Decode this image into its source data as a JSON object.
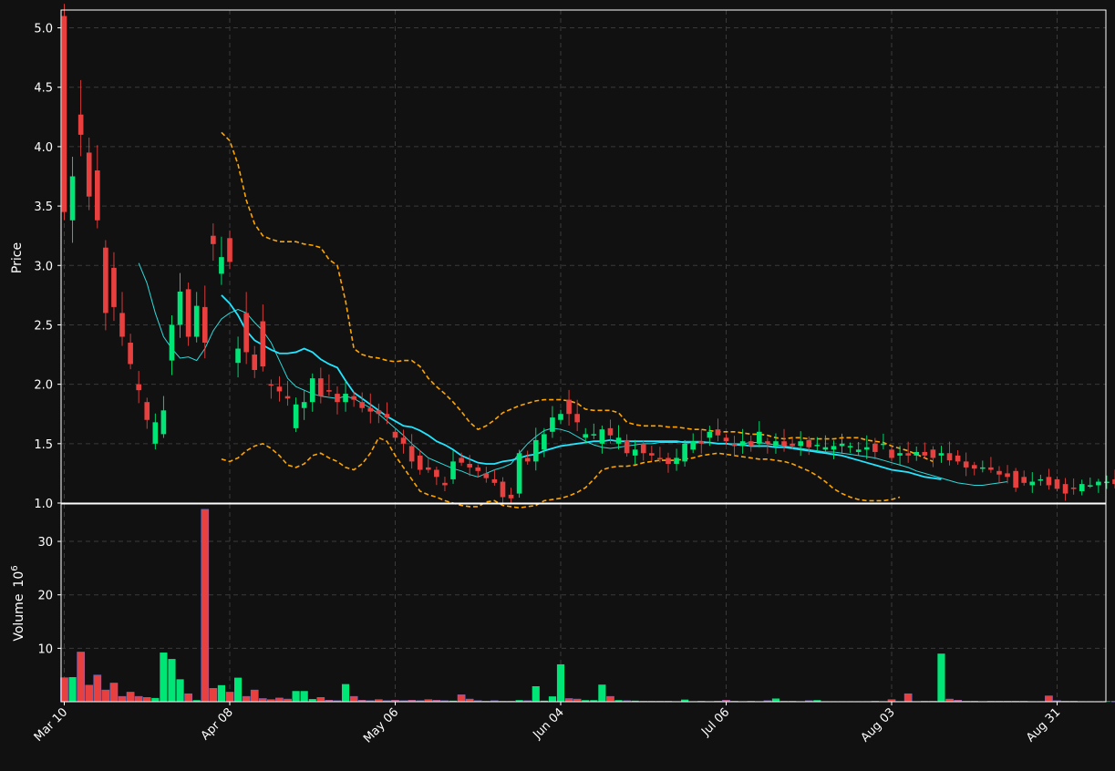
{
  "chart_data": {
    "type": "candlestick",
    "colors": {
      "background": "#111111",
      "up": "#00e676",
      "down": "#e8403f",
      "grid": "#3a3a3a",
      "axis": "#ffffff",
      "ma_fast": "#2fd8d8",
      "ma_slow": "#22e5ff",
      "bollinger": "#ffa500"
    },
    "price_panel": {
      "ylabel": "Price",
      "ylim": [
        1.0,
        5.15
      ],
      "yticks": [
        "1.0",
        "1.5",
        "2.0",
        "2.5",
        "3.0",
        "3.5",
        "4.0",
        "4.5",
        "5.0"
      ],
      "ytick_values": [
        1.0,
        1.5,
        2.0,
        2.5,
        3.0,
        3.5,
        4.0,
        4.5,
        5.0
      ]
    },
    "volume_panel": {
      "ylabel": "Volume",
      "ylabel_unit": "10",
      "ylabel_exp": "6",
      "ylim": [
        0,
        37
      ],
      "yticks": [
        "10",
        "20",
        "30"
      ],
      "ytick_values": [
        10,
        20,
        30
      ]
    },
    "x_axis": {
      "tick_labels": [
        "Mar 10",
        "Apr 08",
        "May 06",
        "Jun 04",
        "Jul 06",
        "Aug 03",
        "Aug 31"
      ],
      "tick_indices": [
        0,
        20,
        40,
        60,
        80,
        100,
        120
      ]
    },
    "grid": true,
    "candles": {
      "open": [
        5.1,
        3.38,
        4.27,
        3.95,
        3.8,
        3.15,
        2.98,
        2.6,
        2.35,
        2.0,
        1.85,
        1.5,
        1.58,
        2.2,
        2.5,
        2.8,
        2.4,
        2.65,
        3.25,
        2.93,
        3.23,
        2.18,
        2.6,
        2.25,
        2.53,
        2.0,
        1.98,
        1.9,
        1.63,
        1.8,
        1.85,
        2.05,
        1.95,
        1.92,
        1.85,
        1.9,
        1.85,
        1.8,
        1.78,
        1.75,
        1.6,
        1.55,
        1.48,
        1.4,
        1.3,
        1.28,
        1.17,
        1.2,
        1.38,
        1.33,
        1.3,
        1.25,
        1.2,
        1.18,
        1.07,
        1.08,
        1.38,
        1.35,
        1.45,
        1.6,
        1.7,
        1.87,
        1.75,
        1.55,
        1.57,
        1.5,
        1.63,
        1.5,
        1.53,
        1.4,
        1.5,
        1.42,
        1.38,
        1.38,
        1.33,
        1.35,
        1.45,
        1.52,
        1.55,
        1.62,
        1.55,
        1.5,
        1.48,
        1.52,
        1.5,
        1.52,
        1.48,
        1.52,
        1.5,
        1.48,
        1.53,
        1.48,
        1.45,
        1.45,
        1.48,
        1.47,
        1.43,
        1.45,
        1.5,
        1.5,
        1.45,
        1.4,
        1.42,
        1.4,
        1.43,
        1.45,
        1.4,
        1.42,
        1.4,
        1.35,
        1.32,
        1.3,
        1.3,
        1.27,
        1.25,
        1.27,
        1.22,
        1.15,
        1.2,
        1.22,
        1.2,
        1.16,
        1.13,
        1.1,
        1.15,
        1.15,
        1.17,
        1.2,
        1.18,
        1.15,
        1.17,
        1.23,
        1.25
      ],
      "close": [
        3.45,
        3.75,
        4.1,
        3.58,
        3.38,
        2.6,
        2.65,
        2.4,
        2.17,
        1.95,
        1.7,
        1.68,
        1.78,
        2.5,
        2.78,
        2.4,
        2.66,
        2.35,
        3.18,
        3.07,
        3.03,
        2.3,
        2.27,
        2.12,
        2.15,
        1.99,
        1.94,
        1.88,
        1.83,
        1.85,
        2.05,
        1.9,
        1.94,
        1.85,
        1.92,
        1.87,
        1.8,
        1.77,
        1.75,
        1.72,
        1.55,
        1.5,
        1.35,
        1.28,
        1.28,
        1.22,
        1.15,
        1.35,
        1.34,
        1.3,
        1.27,
        1.21,
        1.17,
        1.05,
        1.04,
        1.42,
        1.35,
        1.53,
        1.58,
        1.72,
        1.75,
        1.75,
        1.68,
        1.58,
        1.58,
        1.62,
        1.57,
        1.55,
        1.42,
        1.45,
        1.42,
        1.4,
        1.37,
        1.33,
        1.38,
        1.5,
        1.52,
        1.5,
        1.6,
        1.57,
        1.52,
        1.48,
        1.52,
        1.48,
        1.6,
        1.5,
        1.52,
        1.48,
        1.48,
        1.52,
        1.47,
        1.49,
        1.47,
        1.48,
        1.5,
        1.48,
        1.45,
        1.47,
        1.43,
        1.5,
        1.38,
        1.42,
        1.4,
        1.43,
        1.4,
        1.38,
        1.42,
        1.36,
        1.35,
        1.3,
        1.29,
        1.3,
        1.28,
        1.24,
        1.22,
        1.13,
        1.17,
        1.18,
        1.2,
        1.15,
        1.12,
        1.08,
        1.12,
        1.16,
        1.15,
        1.18,
        1.18,
        1.16,
        1.2,
        1.25,
        1.2
      ]
    },
    "volume": [
      4.5,
      4.6,
      9.3,
      3.1,
      5.0,
      2.2,
      3.5,
      1.0,
      1.8,
      1.0,
      0.8,
      0.7,
      9.2,
      8.0,
      4.2,
      1.5,
      0.3,
      36.0,
      2.5,
      3.1,
      1.8,
      4.5,
      1.0,
      2.2,
      0.6,
      0.4,
      0.7,
      0.5,
      2.0,
      2.0,
      0.5,
      0.8,
      0.3,
      0.2,
      3.3,
      1.0,
      0.3,
      0.2,
      0.4,
      0.2,
      0.3,
      0.2,
      0.3,
      0.2,
      0.4,
      0.3,
      0.2,
      0.2,
      1.3,
      0.5,
      0.2,
      0.1,
      0.2,
      0.1,
      0.1,
      0.3,
      0.2,
      2.9,
      0.2,
      1.0,
      7.0,
      0.6,
      0.5,
      0.3,
      0.3,
      3.2,
      1.0,
      0.3,
      0.2,
      0.2,
      0.1,
      0.1,
      0.1,
      0.1,
      0.1,
      0.4,
      0.1,
      0.1,
      0.1,
      0.1,
      0.3,
      0.1,
      0.1,
      0.1,
      0.1,
      0.2,
      0.6,
      0.1,
      0.1,
      0.1,
      0.2,
      0.3,
      0.1,
      0.1,
      0.1,
      0.1,
      0.1,
      0.1,
      0.1,
      0.1,
      0.4,
      0.1,
      1.5,
      0.1,
      0.1,
      0.1,
      9.0,
      0.5,
      0.3,
      0.1,
      0.1,
      0.1,
      0.1,
      0.1,
      0.1,
      0.1,
      0.1,
      0.1,
      0.1,
      1.1,
      0.2,
      0.1,
      0.1,
      0.1,
      0.1,
      0.1,
      0.1,
      0.1,
      0.1,
      0.1,
      0.1,
      0.1,
      0.1,
      0.1,
      0.2,
      0.1,
      0.1,
      0.1,
      0.3,
      0.1
    ],
    "ma_fast": [
      null,
      null,
      null,
      null,
      null,
      null,
      null,
      null,
      null,
      3.02,
      2.85,
      2.6,
      2.4,
      2.3,
      2.22,
      2.23,
      2.2,
      2.3,
      2.45,
      2.55,
      2.6,
      2.63,
      2.6,
      2.52,
      2.45,
      2.35,
      2.2,
      2.05,
      1.98,
      1.95,
      1.92,
      1.9,
      1.89,
      1.88,
      1.9,
      1.88,
      1.84,
      1.8,
      1.75,
      1.69,
      1.63,
      1.57,
      1.5,
      1.44,
      1.38,
      1.35,
      1.32,
      1.29,
      1.27,
      1.24,
      1.22,
      1.25,
      1.28,
      1.3,
      1.33,
      1.42,
      1.5,
      1.56,
      1.61,
      1.63,
      1.62,
      1.6,
      1.56,
      1.52,
      1.49,
      1.47,
      1.46,
      1.47,
      1.48,
      1.49,
      1.5,
      1.5,
      1.51,
      1.51,
      1.51,
      1.52,
      1.52,
      1.52,
      1.51,
      1.5,
      1.5,
      1.5,
      1.5,
      1.51,
      1.51,
      1.5,
      1.49,
      1.48,
      1.47,
      1.46,
      1.45,
      1.44,
      1.43,
      1.43,
      1.42,
      1.41,
      1.4,
      1.39,
      1.38,
      1.36,
      1.34,
      1.32,
      1.3,
      1.27,
      1.25,
      1.23,
      1.21,
      1.19,
      1.17,
      1.16,
      1.15,
      1.15,
      1.16,
      1.17,
      1.18
    ],
    "ma_slow": [
      null,
      null,
      null,
      null,
      null,
      null,
      null,
      null,
      null,
      null,
      null,
      null,
      null,
      null,
      null,
      null,
      null,
      null,
      null,
      2.75,
      2.68,
      2.58,
      2.45,
      2.37,
      2.33,
      2.29,
      2.26,
      2.26,
      2.27,
      2.3,
      2.27,
      2.21,
      2.17,
      2.14,
      2.03,
      1.93,
      1.88,
      1.83,
      1.78,
      1.73,
      1.69,
      1.65,
      1.64,
      1.61,
      1.57,
      1.52,
      1.49,
      1.45,
      1.4,
      1.37,
      1.34,
      1.33,
      1.33,
      1.35,
      1.36,
      1.38,
      1.4,
      1.41,
      1.44,
      1.46,
      1.48,
      1.49,
      1.5,
      1.51,
      1.52,
      1.52,
      1.53,
      1.52,
      1.52,
      1.52,
      1.52,
      1.52,
      1.52,
      1.52,
      1.52,
      1.51,
      1.51,
      1.51,
      1.51,
      1.5,
      1.5,
      1.49,
      1.49,
      1.48,
      1.48,
      1.48,
      1.47,
      1.47,
      1.46,
      1.45,
      1.44,
      1.43,
      1.42,
      1.41,
      1.4,
      1.38,
      1.36,
      1.34,
      1.32,
      1.3,
      1.28,
      1.27,
      1.26,
      1.24,
      1.22,
      1.21,
      1.2
    ],
    "bb_upper": [
      null,
      null,
      null,
      null,
      null,
      null,
      null,
      null,
      null,
      null,
      null,
      null,
      null,
      null,
      null,
      null,
      null,
      null,
      null,
      4.12,
      4.05,
      3.85,
      3.55,
      3.35,
      3.25,
      3.22,
      3.2,
      3.2,
      3.2,
      3.18,
      3.17,
      3.15,
      3.05,
      3.0,
      2.7,
      2.3,
      2.25,
      2.23,
      2.22,
      2.2,
      2.19,
      2.2,
      2.2,
      2.15,
      2.05,
      1.98,
      1.92,
      1.85,
      1.77,
      1.68,
      1.62,
      1.65,
      1.7,
      1.76,
      1.79,
      1.82,
      1.84,
      1.86,
      1.87,
      1.87,
      1.87,
      1.86,
      1.84,
      1.79,
      1.78,
      1.78,
      1.78,
      1.76,
      1.68,
      1.66,
      1.65,
      1.65,
      1.65,
      1.64,
      1.64,
      1.63,
      1.62,
      1.62,
      1.61,
      1.6,
      1.6,
      1.6,
      1.59,
      1.58,
      1.58,
      1.57,
      1.55,
      1.54,
      1.55,
      1.55,
      1.54,
      1.54,
      1.54,
      1.54,
      1.55,
      1.55,
      1.55,
      1.53,
      1.52,
      1.51,
      1.48,
      1.46,
      1.44,
      1.41,
      1.38,
      1.35
    ],
    "bb_lower": [
      null,
      null,
      null,
      null,
      null,
      null,
      null,
      null,
      null,
      null,
      null,
      null,
      null,
      null,
      null,
      null,
      null,
      null,
      null,
      1.37,
      1.35,
      1.38,
      1.44,
      1.48,
      1.5,
      1.46,
      1.4,
      1.32,
      1.3,
      1.33,
      1.4,
      1.42,
      1.38,
      1.35,
      1.3,
      1.28,
      1.33,
      1.42,
      1.55,
      1.52,
      1.4,
      1.3,
      1.2,
      1.1,
      1.07,
      1.05,
      1.02,
      1.0,
      0.98,
      0.97,
      0.97,
      1.01,
      1.02,
      0.98,
      0.97,
      0.96,
      0.97,
      0.98,
      1.02,
      1.03,
      1.04,
      1.06,
      1.09,
      1.13,
      1.2,
      1.28,
      1.3,
      1.31,
      1.31,
      1.32,
      1.34,
      1.35,
      1.36,
      1.36,
      1.36,
      1.37,
      1.38,
      1.4,
      1.41,
      1.42,
      1.41,
      1.4,
      1.39,
      1.38,
      1.37,
      1.37,
      1.36,
      1.35,
      1.33,
      1.3,
      1.27,
      1.23,
      1.18,
      1.12,
      1.08,
      1.05,
      1.03,
      1.02,
      1.02,
      1.02,
      1.03,
      1.05
    ]
  }
}
